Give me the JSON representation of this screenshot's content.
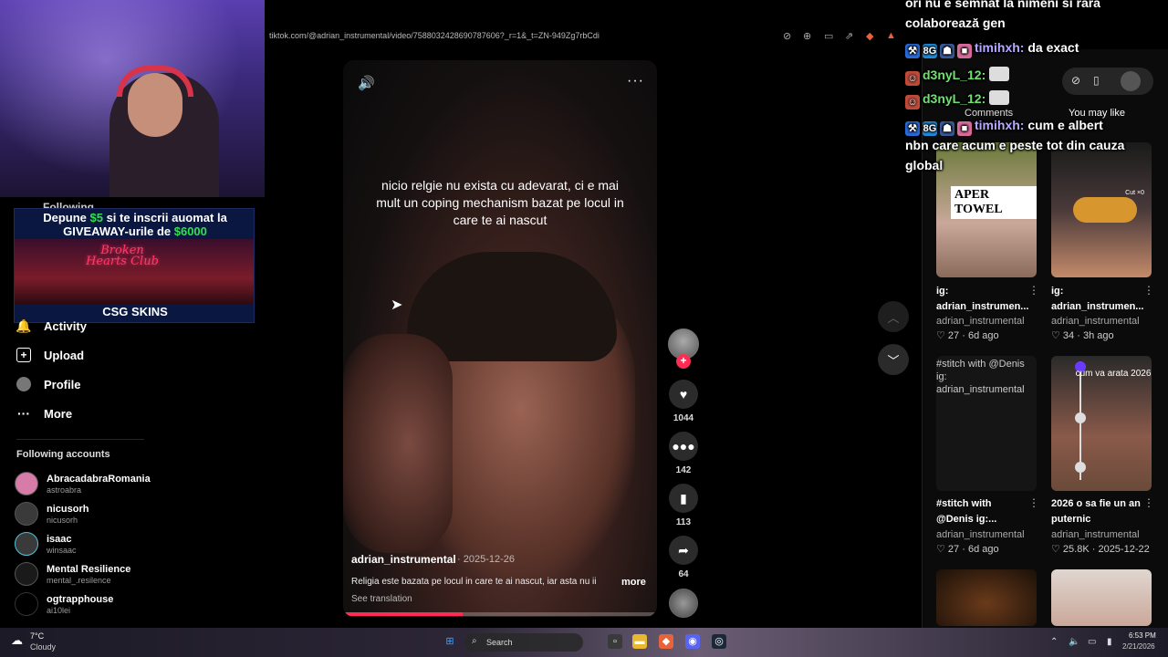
{
  "browser": {
    "url": "tiktok.com/@adrian_instrumental/video/7588032428690787606?_r=1&_t=ZN-949Zg7rbCdi"
  },
  "promo": {
    "line1_a": "Depune ",
    "line1_money": "$5",
    "line1_b": " si te inscrii auomat la",
    "line2_a": "GIVEAWAY-urile de ",
    "line2_money": "$6000",
    "club_text": "Broken Hearts Club",
    "brand": "CSG SKINS"
  },
  "sidebar": {
    "following_partial": "Following",
    "items": [
      {
        "label": "Activity",
        "icon": "bell-icon"
      },
      {
        "label": "Upload",
        "icon": "plus-square-icon"
      },
      {
        "label": "Profile",
        "icon": "profile-icon"
      },
      {
        "label": "More",
        "icon": "more-dots-icon"
      }
    ],
    "following_title": "Following accounts",
    "accounts": [
      {
        "name": "AbracadabraRomania",
        "handle": "astroabra"
      },
      {
        "name": "nicusorh",
        "handle": "nicusorh"
      },
      {
        "name": "isaac",
        "handle": "winsaac"
      },
      {
        "name": "Mental Resilience",
        "handle": "mental_.resilence"
      },
      {
        "name": "ogtrapphouse",
        "handle": "ai10lei"
      }
    ]
  },
  "video": {
    "caption": "nicio relgie nu exista cu adevarat, ci e mai mult un coping mechanism bazat pe locul in care te ai nascut",
    "author": "adrian_instrumental",
    "date": "· 2025-12-26",
    "description": "Religia este bazata pe locul in care te ai nascut, iar asta nu ii",
    "more": "more",
    "see_translation": "See translation",
    "progress": 0.38,
    "likes": "1044",
    "comments": "142",
    "saves": "113",
    "shares": "64",
    "follow_plus": "+"
  },
  "right_panel": {
    "tab_comments": "Comments",
    "tab_may_like": "You may like",
    "cards": [
      {
        "title": "ig: adrian_instrumen...",
        "author": "adrian_instrumental",
        "likes": "27",
        "age": "6d ago",
        "overlay": "APER TOWEL"
      },
      {
        "title": "ig: adrian_instrumen...",
        "author": "adrian_instrumental",
        "likes": "34",
        "age": "3h ago",
        "overlay": "Cut ×0"
      },
      {
        "title": "#stitch with @Denis ig:...",
        "author": "adrian_instrumental",
        "likes": "27",
        "age": "6d ago",
        "overlay": "#stitch with @Denis ig: adrian_instrumental"
      },
      {
        "title": "2026 o sa fie un an puternic",
        "author": "adrian_instrumental",
        "likes": "25.8K",
        "age": "2025-12-22",
        "overlay": "cum va arata 2026"
      }
    ]
  },
  "chat": {
    "msg0": "ori nu e semnat la nimeni si rara colaborează gen",
    "msg1_user": "timihxh:",
    "msg1_text": " da exact",
    "msg2_user": "d3nyL_12:",
    "msg3_user": "d3nyL_12:",
    "msg4_user": "timihxh:",
    "msg4_text": " cum e albert",
    "msg4_cont": "nbn care acum e peste tot din cauza global",
    "badge_text": "8G"
  },
  "taskbar": {
    "temp": "7°C",
    "weather": "Cloudy",
    "search": "Search",
    "time": "6:53 PM",
    "date": "2/21/2026"
  },
  "colors": {
    "accent": "#fe2c55",
    "money": "#31e04d"
  }
}
